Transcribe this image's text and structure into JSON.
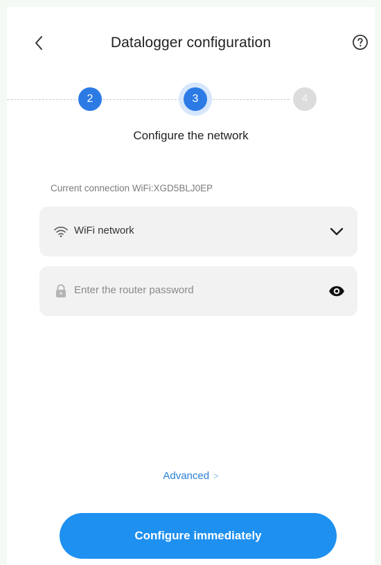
{
  "header": {
    "title": "Datalogger configuration",
    "back_icon": "chevron-left-icon",
    "help_icon": "question-circle-icon"
  },
  "stepper": {
    "steps": [
      {
        "label": "2",
        "state": "done"
      },
      {
        "label": "3",
        "state": "active"
      },
      {
        "label": "4",
        "state": "todo"
      }
    ],
    "current_title": "Configure the network"
  },
  "connection": {
    "current_text": "Current connection WiFi:XGD5BLJ0EP"
  },
  "form": {
    "wifi": {
      "label": "WiFi network",
      "icon": "wifi-icon",
      "dropdown_icon": "chevron-down-icon"
    },
    "password": {
      "placeholder": "Enter the router password",
      "icon": "lock-icon",
      "toggle_icon": "eye-icon"
    }
  },
  "advanced": {
    "label": "Advanced",
    "chevron": ">"
  },
  "actions": {
    "primary_label": "Configure immediately"
  },
  "colors": {
    "accent": "#2c7be5",
    "button": "#1e90f0",
    "link": "#2a7fd3",
    "field_bg": "#f2f2f3"
  }
}
